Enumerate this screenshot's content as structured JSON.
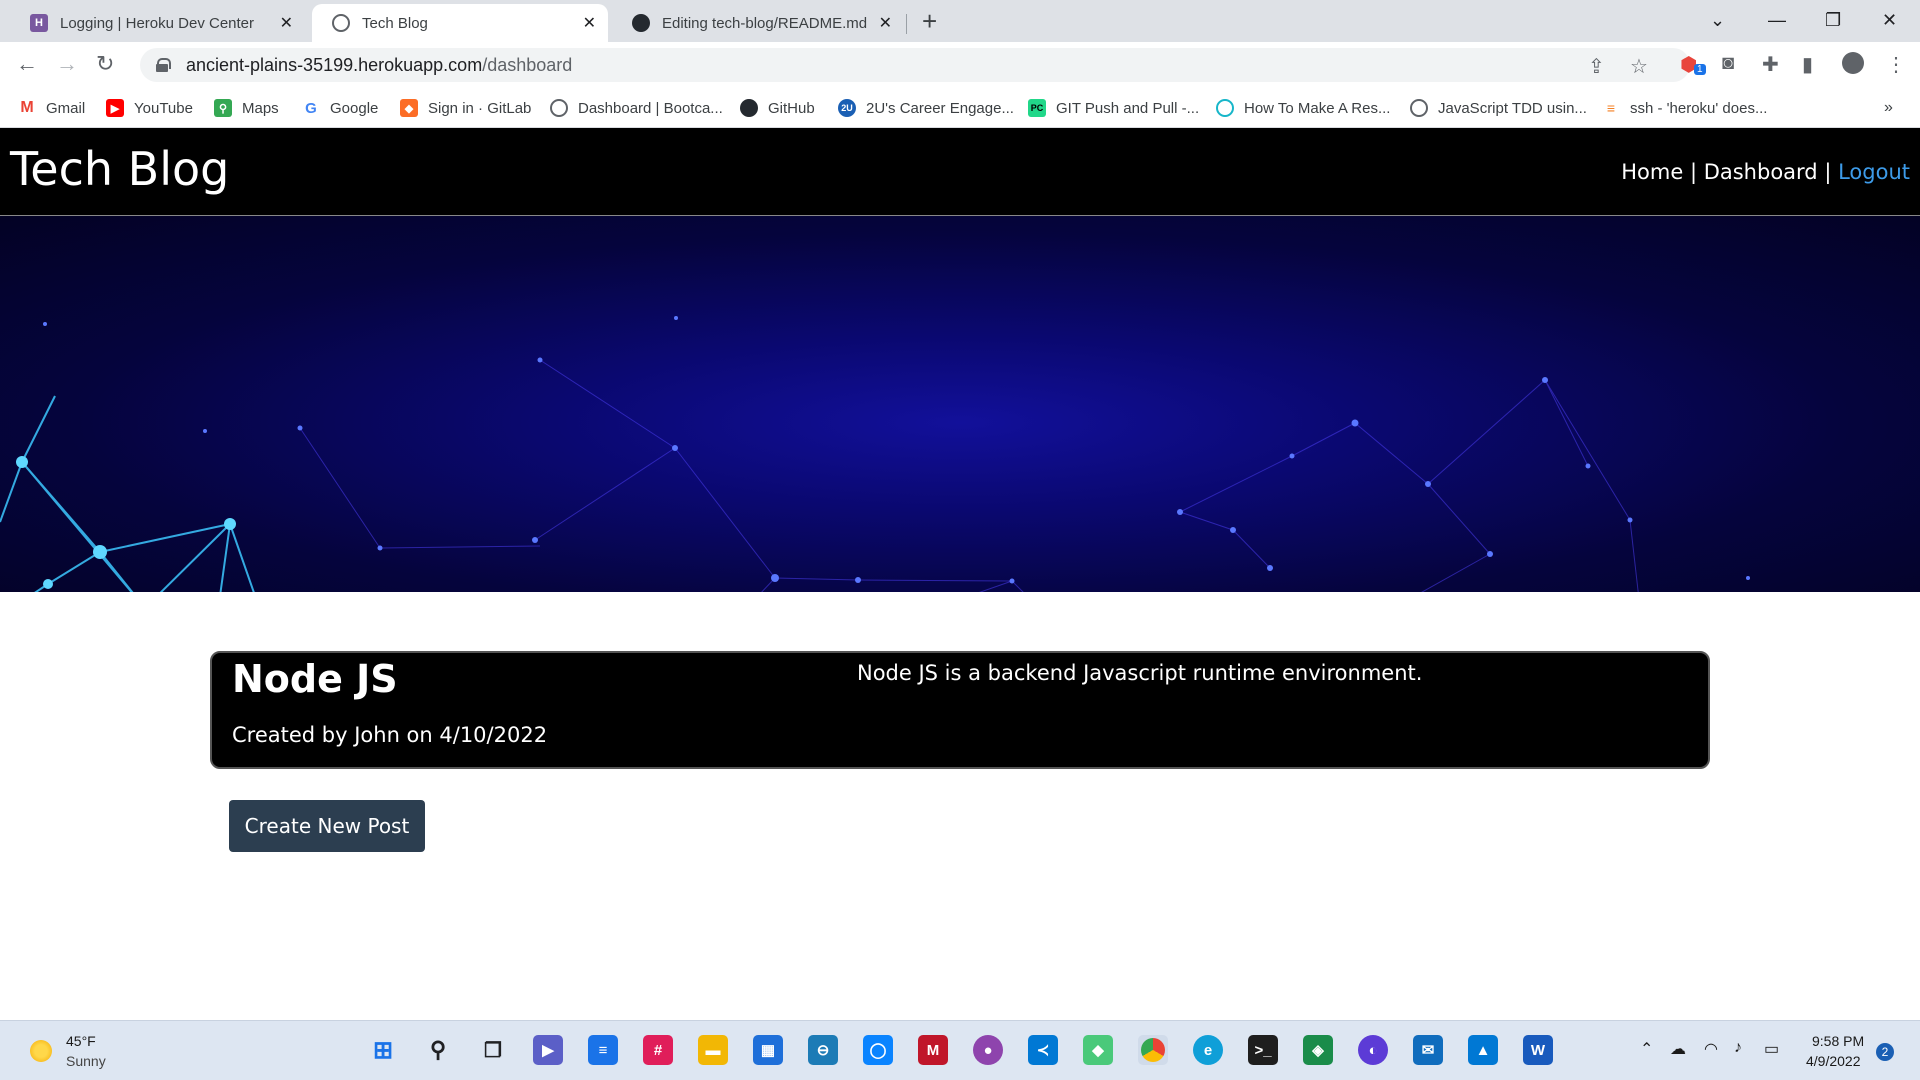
{
  "browser": {
    "tabs": [
      {
        "title": "Logging | Heroku Dev Center",
        "favicon": "heroku-icon",
        "active": false
      },
      {
        "title": "Tech Blog",
        "favicon": "globe-icon",
        "active": true
      },
      {
        "title": "Editing tech-blog/README.md at",
        "favicon": "github-icon",
        "active": false
      }
    ],
    "url_host": "ancient-plains-35199.herokuapp.com",
    "url_path": "/dashboard",
    "bookmarks": [
      {
        "label": "Gmail",
        "icon": "gmail-icon"
      },
      {
        "label": "YouTube",
        "icon": "youtube-icon"
      },
      {
        "label": "Maps",
        "icon": "maps-icon"
      },
      {
        "label": "Google",
        "icon": "google-icon"
      },
      {
        "label": "Sign in · GitLab",
        "icon": "gitlab-icon"
      },
      {
        "label": "Dashboard | Bootca...",
        "icon": "globe-icon"
      },
      {
        "label": "GitHub",
        "icon": "github-icon"
      },
      {
        "label": "2U's Career Engage...",
        "icon": "2u-icon"
      },
      {
        "label": "GIT Push and Pull -...",
        "icon": "pycharm-icon"
      },
      {
        "label": "How To Make A Res...",
        "icon": "site-icon"
      },
      {
        "label": "JavaScript TDD usin...",
        "icon": "globe-icon"
      },
      {
        "label": "ssh - 'heroku' does...",
        "icon": "stackoverflow-icon"
      }
    ],
    "extension_badge": "1"
  },
  "site": {
    "brand": "Tech Blog",
    "nav": {
      "home": "Home",
      "dashboard": "Dashboard",
      "logout": "Logout",
      "separator": "|"
    }
  },
  "posts": [
    {
      "title": "Node JS",
      "meta": "Created by John on 4/10/2022",
      "body": "Node JS is a backend Javascript runtime environment."
    }
  ],
  "actions": {
    "create_post": "Create New Post"
  },
  "taskbar": {
    "weather_temp": "45°F",
    "weather_condition": "Sunny",
    "time": "9:58 PM",
    "date": "4/9/2022",
    "notification_count": "2"
  },
  "colors": {
    "header_bg": "#000000",
    "logout_link": "#3d9be9",
    "button_bg": "#2c3e50",
    "hero_bg": "#0a0870"
  }
}
